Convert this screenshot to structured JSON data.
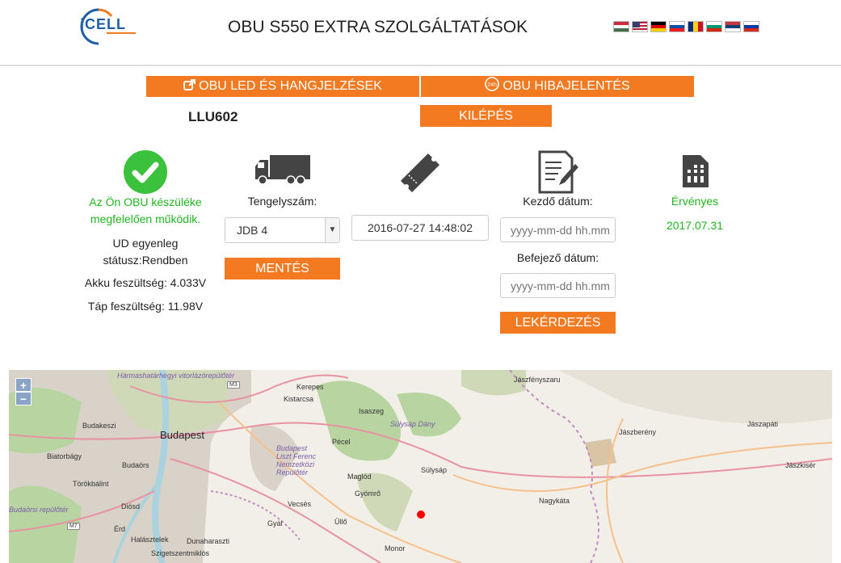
{
  "header": {
    "logo_text": "iCELL",
    "title": "OBU S550 EXTRA SZOLGÁLTATÁSOK",
    "flags": [
      "hu",
      "us",
      "de",
      "sk",
      "ro",
      "bg",
      "rs",
      "ru"
    ]
  },
  "nav": {
    "led_label": "OBU LED ÉS HANGJELZÉSEK",
    "hiba_label": "OBU HIBAJELENTÉS",
    "hiba_icon_text": "24h",
    "logout_label": "KILÉPÉS"
  },
  "plate": "LLU602",
  "status": {
    "message": "Az Ön OBU készüléke megfelelően működik.",
    "ud_balance": "UD egyenleg státusz:Rendben",
    "battery": "Akku feszültség: 4.033V",
    "supply": "Táp feszültség: 11.98V"
  },
  "axle": {
    "label": "Tengelyszám:",
    "selected": "JDB 4",
    "save_label": "MENTÉS"
  },
  "ticket": {
    "datetime": "2016-07-27 14:48:02"
  },
  "query": {
    "start_label": "Kezdő dátum:",
    "start_placeholder": "yyyy-mm-dd hh.mm",
    "end_label": "Befejező dátum:",
    "end_placeholder": "yyyy-mm-dd hh.mm",
    "button_label": "LEKÉRDEZÉS"
  },
  "validity": {
    "label": "Érvényes",
    "date": "2017.07.31"
  },
  "map": {
    "zoom_in": "+",
    "zoom_out": "−",
    "places": {
      "budapest": "Budapest",
      "harmashatar": "Hármashatárhegyi vitorlázórepülőtér",
      "budakeszi": "Budakeszi",
      "biatorbagy": "Biatorbágy",
      "budaors": "Budaörs",
      "torokbalint": "Törökbálint",
      "repuloter": "Budaörsi repülőtér",
      "diosd": "Diósd",
      "halasztelek": "Halásztelek",
      "szigetszentmiklos": "Szigetszentmiklós",
      "dunaharaszti": "Dunaharaszti",
      "erd": "Érd",
      "kerepes": "Kerepes",
      "kistarcsa": "Kistarcsa",
      "isaszeg": "Isaszeg",
      "sulysap_dany": "Sülysáp Dány",
      "pecel": "Pécel",
      "liszt": "Budapest Liszt Ferenc Nemzetközi Repülőtér",
      "maglod": "Maglód",
      "gyomro": "Gyömrő",
      "vecses": "Vecsés",
      "ullo": "Üllő",
      "gyal": "Gyál",
      "monor": "Monor",
      "sulysap": "Sülysáp",
      "nagykata": "Nagykáta",
      "jaszfenyszaru": "Jászfényszaru",
      "jaszbereny": "Jászberény",
      "jaszapati": "Jászapáti",
      "jaszkiser": "Jászkisér"
    },
    "roads": {
      "m3": "M3",
      "m7": "M7"
    }
  }
}
